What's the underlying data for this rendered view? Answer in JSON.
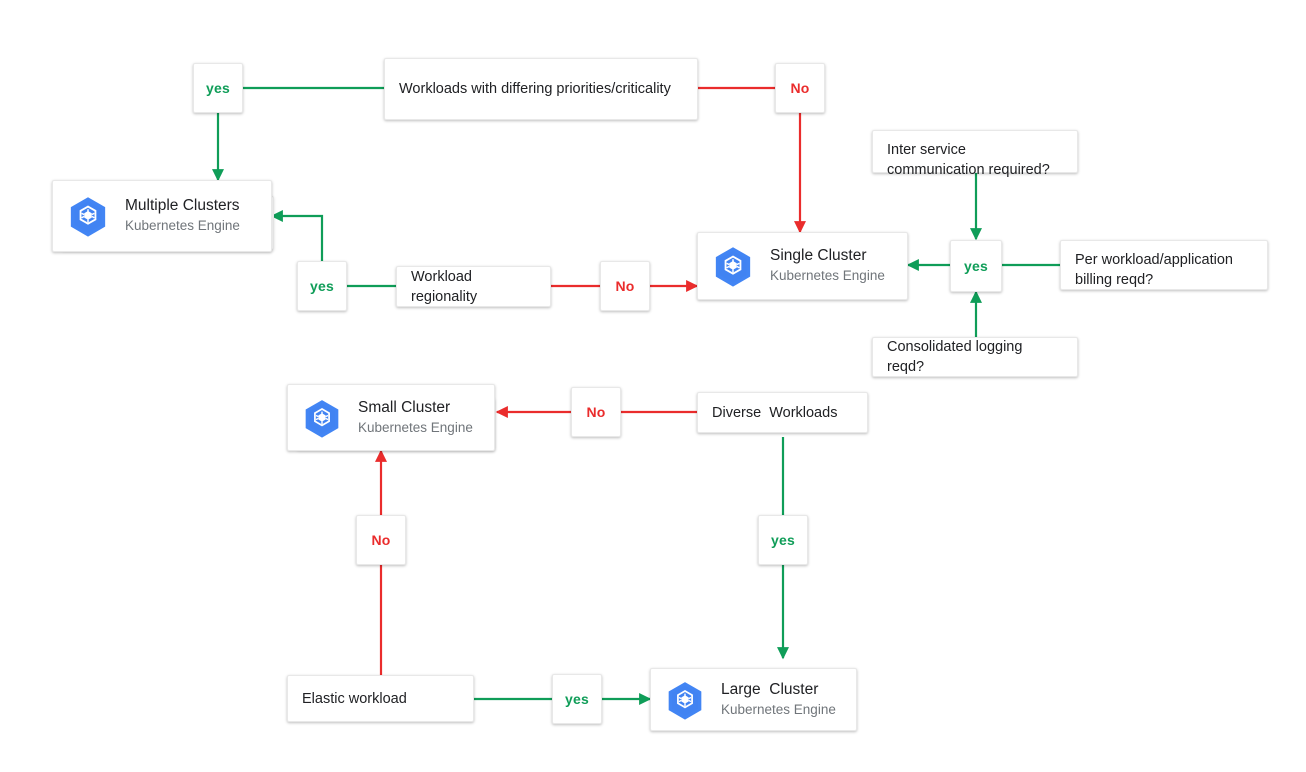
{
  "diagram": {
    "title": "GKE cluster sizing decision flowchart",
    "colors": {
      "yes_green": "#0f9d58",
      "no_red": "#ea2c2c",
      "text": "#202124",
      "subtext": "#70757a",
      "gke_blue": "#4285f4",
      "card_bg": "#ffffff",
      "background": "#ffffff"
    },
    "nodes": {
      "workloads_priorities": {
        "label": "Workloads with differing priorities/criticality"
      },
      "yes_top_left": {
        "label": "yes"
      },
      "no_top_right": {
        "label": "No"
      },
      "multiple_clusters": {
        "title": "Multiple Clusters",
        "subtitle": "Kubernetes Engine",
        "icon": "gke-icon"
      },
      "yes_regionality": {
        "label": "yes"
      },
      "workload_regionality": {
        "label": "Workload regionality"
      },
      "no_regionality": {
        "label": "No"
      },
      "single_cluster": {
        "title": "Single Cluster",
        "subtitle": "Kubernetes Engine",
        "icon": "gke-icon"
      },
      "inter_service": {
        "label": "Inter service communication required?"
      },
      "yes_hub": {
        "label": "yes"
      },
      "per_workload_billing": {
        "label": "Per workload/application billing reqd?"
      },
      "consolidated_logging": {
        "label": "Consolidated logging reqd?"
      },
      "small_cluster": {
        "title": "Small Cluster",
        "subtitle": "Kubernetes Engine",
        "icon": "gke-icon"
      },
      "no_diverse": {
        "label": "No"
      },
      "diverse_workloads": {
        "label": "Diverse  Workloads"
      },
      "yes_diverse": {
        "label": "yes"
      },
      "no_elastic": {
        "label": "No"
      },
      "elastic_workload": {
        "label": "Elastic workload"
      },
      "yes_elastic": {
        "label": "yes"
      },
      "large_cluster": {
        "title": "Large  Cluster",
        "subtitle": "Kubernetes Engine",
        "icon": "gke-icon"
      }
    }
  },
  "chart_data": {
    "type": "diagram",
    "title": "GKE cluster sizing decision flowchart",
    "nodes": [
      {
        "id": "workloads_priorities",
        "text": "Workloads with differing priorities/criticality",
        "kind": "decision"
      },
      {
        "id": "yes_top_left",
        "text": "yes",
        "kind": "edge-label"
      },
      {
        "id": "no_top_right",
        "text": "No",
        "kind": "edge-label"
      },
      {
        "id": "multiple_clusters",
        "text": "Multiple Clusters / Kubernetes Engine",
        "kind": "product"
      },
      {
        "id": "yes_regionality",
        "text": "yes",
        "kind": "edge-label"
      },
      {
        "id": "workload_regionality",
        "text": "Workload regionality",
        "kind": "decision"
      },
      {
        "id": "no_regionality",
        "text": "No",
        "kind": "edge-label"
      },
      {
        "id": "single_cluster",
        "text": "Single Cluster / Kubernetes Engine",
        "kind": "product"
      },
      {
        "id": "inter_service",
        "text": "Inter service communication required?",
        "kind": "decision"
      },
      {
        "id": "yes_hub",
        "text": "yes",
        "kind": "edge-label"
      },
      {
        "id": "per_workload_billing",
        "text": "Per workload/application billing reqd?",
        "kind": "decision"
      },
      {
        "id": "consolidated_logging",
        "text": "Consolidated logging reqd?",
        "kind": "decision"
      },
      {
        "id": "small_cluster",
        "text": "Small Cluster / Kubernetes Engine",
        "kind": "product"
      },
      {
        "id": "no_diverse",
        "text": "No",
        "kind": "edge-label"
      },
      {
        "id": "diverse_workloads",
        "text": "Diverse  Workloads",
        "kind": "decision"
      },
      {
        "id": "yes_diverse",
        "text": "yes",
        "kind": "edge-label"
      },
      {
        "id": "no_elastic",
        "text": "No",
        "kind": "edge-label"
      },
      {
        "id": "elastic_workload",
        "text": "Elastic workload",
        "kind": "decision"
      },
      {
        "id": "yes_elastic",
        "text": "yes",
        "kind": "edge-label"
      },
      {
        "id": "large_cluster",
        "text": "Large  Cluster / Kubernetes Engine",
        "kind": "product"
      }
    ],
    "edges": [
      {
        "from": "workloads_priorities",
        "to": "yes_top_left",
        "label": "yes",
        "color": "#0f9d58",
        "arrow": false
      },
      {
        "from": "yes_top_left",
        "to": "multiple_clusters",
        "label": "",
        "color": "#0f9d58",
        "arrow": true
      },
      {
        "from": "workloads_priorities",
        "to": "no_top_right",
        "label": "No",
        "color": "#ea2c2c",
        "arrow": false
      },
      {
        "from": "no_top_right",
        "to": "single_cluster",
        "label": "",
        "color": "#ea2c2c",
        "arrow": true
      },
      {
        "from": "workload_regionality",
        "to": "yes_regionality",
        "label": "yes",
        "color": "#0f9d58",
        "arrow": false
      },
      {
        "from": "yes_regionality",
        "to": "multiple_clusters",
        "label": "",
        "color": "#0f9d58",
        "arrow": true
      },
      {
        "from": "workload_regionality",
        "to": "no_regionality",
        "label": "No",
        "color": "#ea2c2c",
        "arrow": false
      },
      {
        "from": "no_regionality",
        "to": "single_cluster",
        "label": "",
        "color": "#ea2c2c",
        "arrow": true
      },
      {
        "from": "inter_service",
        "to": "yes_hub",
        "label": "yes",
        "color": "#0f9d58",
        "arrow": true
      },
      {
        "from": "per_workload_billing",
        "to": "yes_hub",
        "label": "yes",
        "color": "#0f9d58",
        "arrow": false
      },
      {
        "from": "consolidated_logging",
        "to": "yes_hub",
        "label": "yes",
        "color": "#0f9d58",
        "arrow": true
      },
      {
        "from": "yes_hub",
        "to": "single_cluster",
        "label": "",
        "color": "#0f9d58",
        "arrow": true
      },
      {
        "from": "diverse_workloads",
        "to": "no_diverse",
        "label": "No",
        "color": "#ea2c2c",
        "arrow": false
      },
      {
        "from": "no_diverse",
        "to": "small_cluster",
        "label": "",
        "color": "#ea2c2c",
        "arrow": true
      },
      {
        "from": "diverse_workloads",
        "to": "yes_diverse",
        "label": "yes",
        "color": "#0f9d58",
        "arrow": false
      },
      {
        "from": "yes_diverse",
        "to": "large_cluster",
        "label": "",
        "color": "#0f9d58",
        "arrow": true
      },
      {
        "from": "elastic_workload",
        "to": "no_elastic",
        "label": "No",
        "color": "#ea2c2c",
        "arrow": false
      },
      {
        "from": "no_elastic",
        "to": "small_cluster",
        "label": "",
        "color": "#ea2c2c",
        "arrow": true
      },
      {
        "from": "elastic_workload",
        "to": "yes_elastic",
        "label": "yes",
        "color": "#0f9d58",
        "arrow": false
      },
      {
        "from": "yes_elastic",
        "to": "large_cluster",
        "label": "",
        "color": "#0f9d58",
        "arrow": true
      }
    ]
  }
}
